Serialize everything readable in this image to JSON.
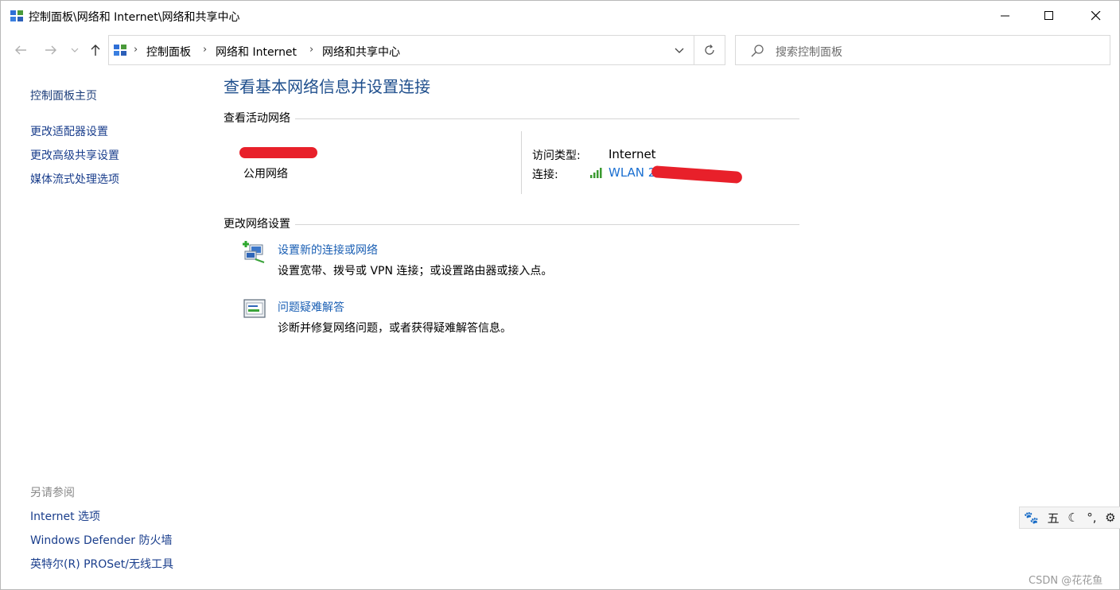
{
  "window": {
    "title": "控制面板\\网络和 Internet\\网络和共享中心"
  },
  "address_bar": {
    "breadcrumbs": [
      "控制面板",
      "网络和 Internet",
      "网络和共享中心"
    ]
  },
  "search": {
    "placeholder": "搜索控制面板"
  },
  "sidebar": {
    "home": "控制面板主页",
    "items": [
      "更改适配器设置",
      "更改高级共享设置",
      "媒体流式处理选项"
    ],
    "see_also_heading": "另请参阅",
    "see_also": [
      "Internet 选项",
      "Windows Defender 防火墙",
      "英特尔(R) PROSet/无线工具"
    ]
  },
  "main": {
    "heading": "查看基本网络信息并设置连接",
    "active_networks_heading": "查看活动网络",
    "network": {
      "type": "公用网络",
      "access_type_label": "访问类型:",
      "access_type_value": "Internet",
      "connection_label": "连接:",
      "connection_value": "WLAN 2"
    },
    "change_settings_heading": "更改网络设置",
    "tasks": [
      {
        "title": "设置新的连接或网络",
        "description": "设置宽带、拨号或 VPN 连接；或设置路由器或接入点。",
        "icon": "new-connection-icon"
      },
      {
        "title": "问题疑难解答",
        "description": "诊断并修复网络问题，或者获得疑难解答信息。",
        "icon": "troubleshoot-icon"
      }
    ]
  },
  "ime_toolbar": {
    "mode": "五"
  },
  "watermark": "CSDN @花花鱼",
  "colors": {
    "heading": "#1e4e8c",
    "link": "#1a5fb4",
    "redaction": "#e8202a"
  }
}
